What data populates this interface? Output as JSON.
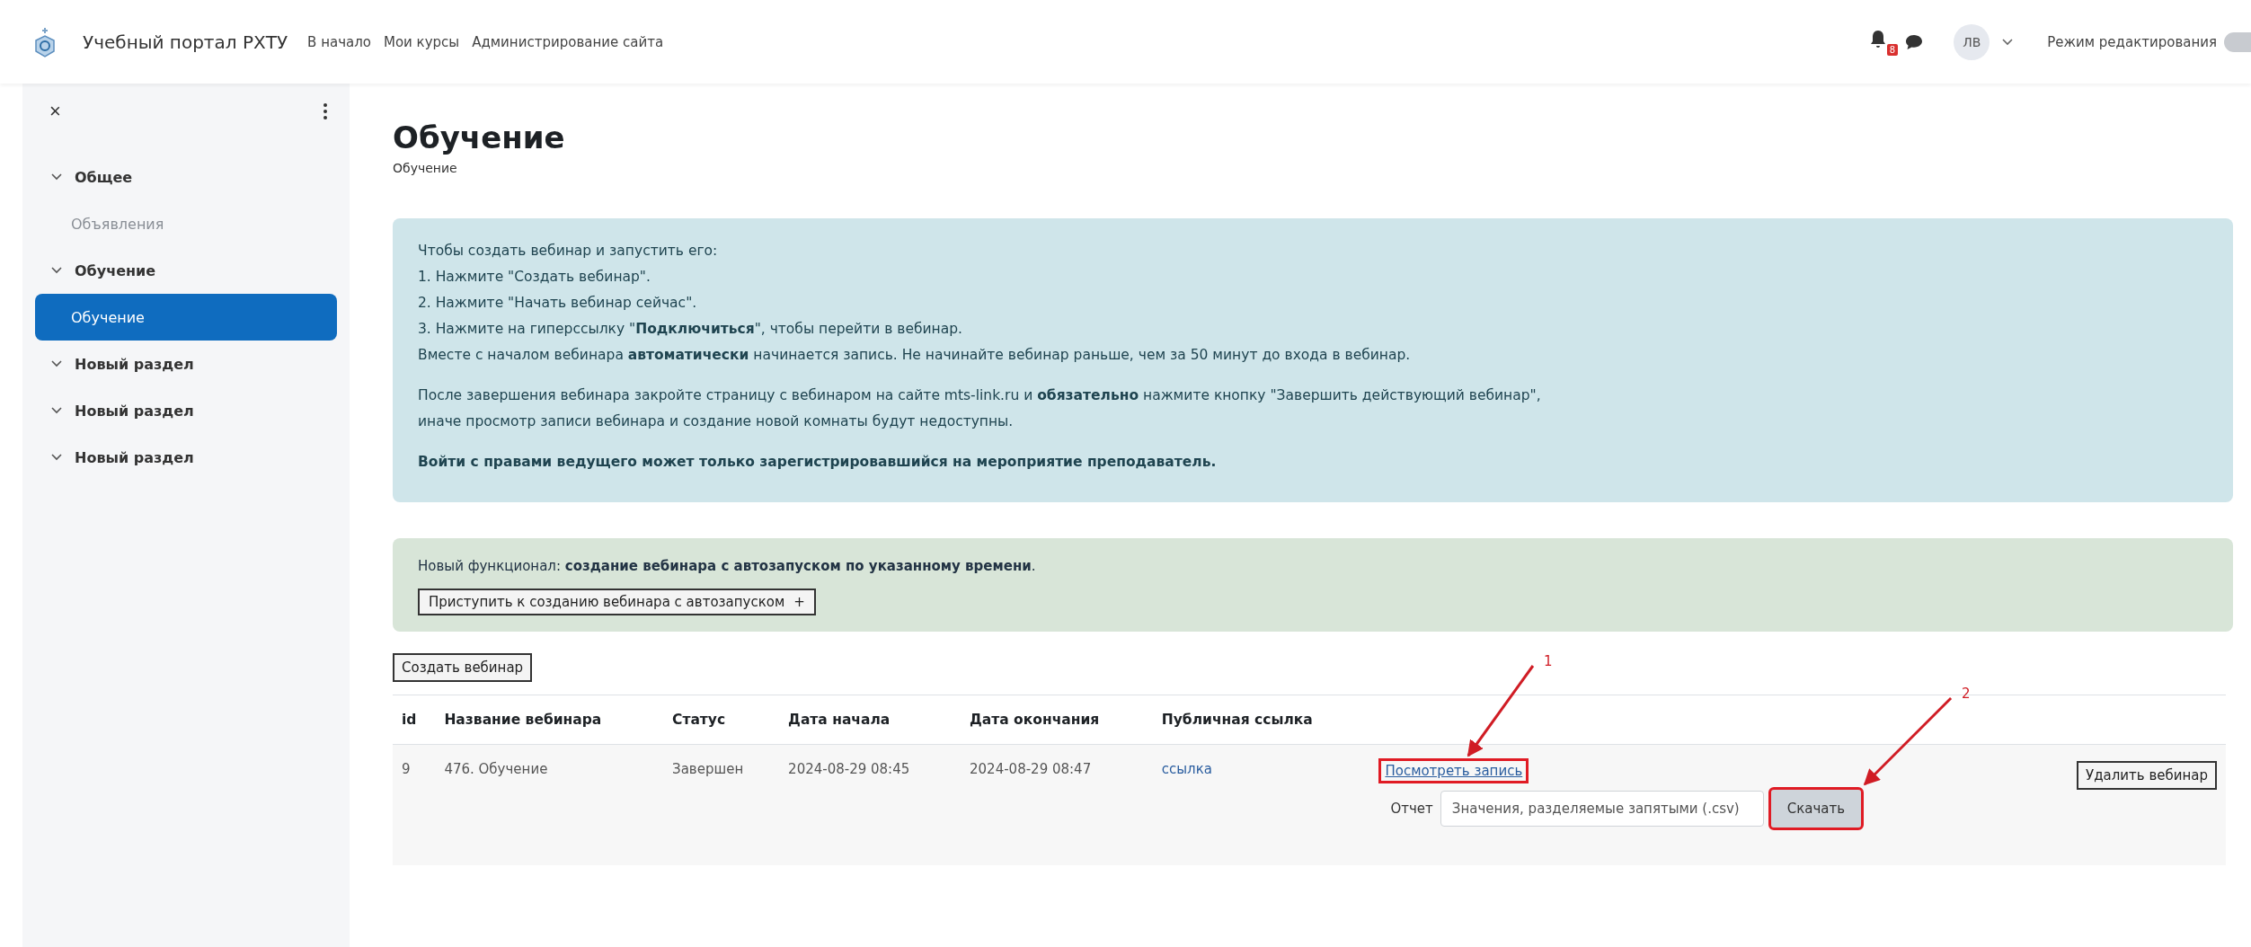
{
  "navbar": {
    "site_name": "Учебный портал РХТУ",
    "links": [
      "В начало",
      "Мои курсы",
      "Администрирование сайта"
    ],
    "notification_count": "8",
    "user_initials": "ЛВ",
    "edit_mode": {
      "label": "Режим редактирования",
      "on": false
    }
  },
  "sidebar": {
    "close": "×",
    "items": [
      {
        "label": "Общее",
        "expanded": true,
        "children": [
          {
            "label": "Объявления",
            "selected": false,
            "dimmed": true
          }
        ]
      },
      {
        "label": "Обучение",
        "expanded": true,
        "children": [
          {
            "label": "Обучение",
            "selected": true
          }
        ]
      },
      {
        "label": "Новый раздел",
        "expanded": true
      },
      {
        "label": "Новый раздел",
        "expanded": true
      },
      {
        "label": "Новый раздел",
        "expanded": true
      }
    ]
  },
  "page": {
    "title": "Обучение",
    "breadcrumb": "Обучение"
  },
  "info_box": {
    "lines": [
      "Чтобы создать вебинар и запустить его:",
      "1. Нажмите \"Создать вебинар\".",
      "2. Нажмите \"Начать вебинар сейчас\".",
      "3. Нажмите на гиперссылку \"**Подключиться**\", чтобы перейти в вебинар.",
      "Вместе с началом вебинара **автоматически** начинается запись. Не начинайте вебинар раньше, чем за 50 минут до входа в вебинар."
    ],
    "paragraph_lines": [
      "После завершения вебинара закройте страницу с вебинаром на сайте mts-link.ru и **обязательно** нажмите кнопку \"Завершить действующий вебинар\",",
      "иначе просмотр записи вебинара и создание новой комнаты будут недоступны."
    ],
    "warning": "Войти с правами ведущего может только зарегистрировавшийся на мероприятие преподаватель."
  },
  "feature_box": {
    "text": "Новый функционал: **создание вебинара с автозапуском по указанному времени**.",
    "button": "Приступить к созданию вебинара с автозапуском",
    "button_icon": "+"
  },
  "create_button": "Создать вебинар",
  "table": {
    "columns": [
      "id",
      "Название вебинара",
      "Статус",
      "Дата начала",
      "Дата окончания",
      "Публичная ссылка"
    ],
    "rows": [
      {
        "cells": [
          "9",
          "476. Обучение",
          "Завершен",
          "2024-08-29 08:45",
          "2024-08-29 08:47"
        ],
        "public_link": "ссылка",
        "view_record": {
          "label": "Посмотреть запись",
          "highlighted": true
        },
        "report_label": "Отчет",
        "report_format": "Значения, разделяемые запятыми (.csv)",
        "download": {
          "label": "Скачать",
          "highlighted": true
        },
        "delete": "Удалить вебинар"
      }
    ]
  },
  "annotations": [
    {
      "label": "1"
    },
    {
      "label": "2"
    }
  ]
}
